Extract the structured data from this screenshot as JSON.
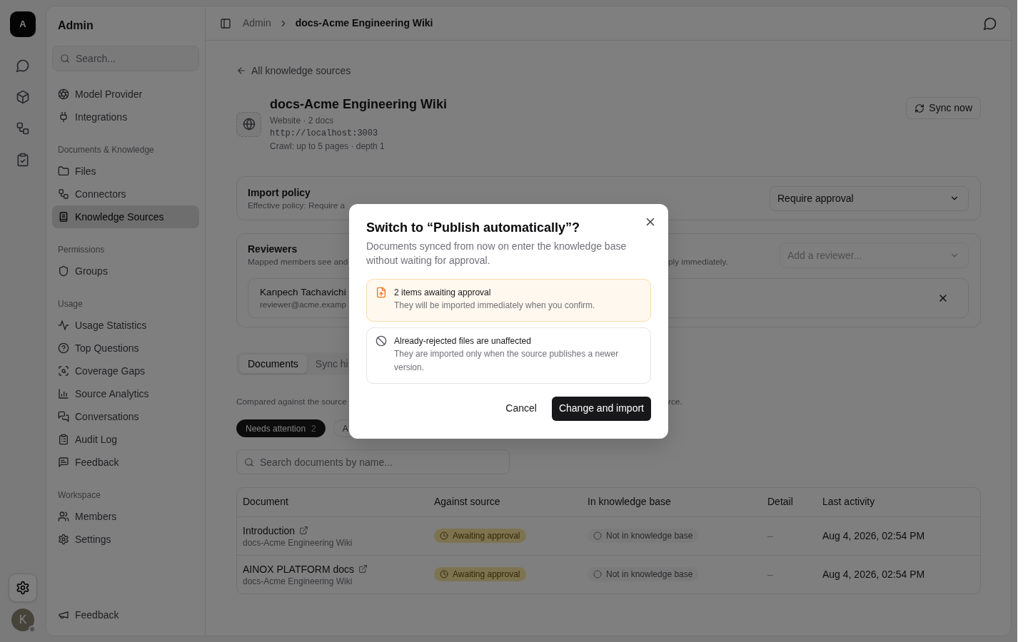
{
  "rail": {
    "logo": "A",
    "nav": [
      {
        "selected": false
      },
      {
        "selected": false
      },
      {
        "selected": false
      },
      {
        "selected": false
      }
    ],
    "settings": {
      "selected": true
    },
    "avatar": {
      "initial": "K",
      "status_dot": true
    }
  },
  "sidebar": {
    "title": "Admin",
    "search": {
      "placeholder": "Search..."
    },
    "sections": [
      {
        "items": [
          {
            "label": "Model Provider",
            "selected": false
          },
          {
            "label": "Integrations",
            "selected": false
          }
        ]
      },
      {
        "heading": "Documents & Knowledge",
        "items": [
          {
            "label": "Files",
            "selected": false
          },
          {
            "label": "Connectors",
            "selected": false
          },
          {
            "label": "Knowledge Sources",
            "selected": true
          }
        ]
      },
      {
        "heading": "Permissions",
        "items": [
          {
            "label": "Groups",
            "selected": false
          }
        ]
      },
      {
        "heading": "Usage",
        "items": [
          {
            "label": "Usage Statistics",
            "selected": false
          },
          {
            "label": "Top Questions",
            "selected": false
          },
          {
            "label": "Coverage Gaps",
            "selected": false
          },
          {
            "label": "Source Analytics",
            "selected": false
          },
          {
            "label": "Conversations",
            "selected": false
          },
          {
            "label": "Audit Log",
            "selected": false
          },
          {
            "label": "Feedback",
            "selected": false
          }
        ]
      },
      {
        "heading": "Workspace",
        "items": [
          {
            "label": "Members",
            "selected": false
          },
          {
            "label": "Settings",
            "selected": false
          }
        ]
      }
    ],
    "footer": {
      "label": "Feedback"
    }
  },
  "header": {
    "breadcrumbs": [
      {
        "label": "Admin",
        "current": false
      },
      {
        "label": "docs-Acme Engineering Wiki",
        "current": true
      }
    ]
  },
  "source": {
    "back_link": "All knowledge sources",
    "title": "docs-Acme Engineering Wiki",
    "meta": "Website · 2 docs",
    "url": "http://localhost:3003",
    "crawl": "Crawl: up to 5 pages · depth 1",
    "sync_button": "Sync now"
  },
  "import_policy": {
    "title": "Import policy",
    "description": "Effective policy: Require a",
    "select": {
      "value": "Require approval"
    }
  },
  "reviewers": {
    "title": "Reviewers",
    "description": "Mapped members see and",
    "description_tail": "ply immediately.",
    "select": {
      "placeholder": "Add a reviewer..."
    },
    "members": [
      {
        "name": "Kanpech Tachavichi",
        "email": "reviewer@acme.examp"
      }
    ]
  },
  "documents": {
    "tabs": [
      {
        "label": "Documents",
        "selected": true
      },
      {
        "label": "Sync hi",
        "selected": false
      }
    ],
    "note": "Compared against the source",
    "note_tail": "rce.",
    "filters": [
      {
        "label": "Needs attention",
        "count": "2",
        "selected": true
      },
      {
        "label": "A",
        "selected": false
      }
    ],
    "search": {
      "placeholder": "Search documents by name..."
    },
    "table": {
      "columns": [
        "Document",
        "Against source",
        "In knowledge base",
        "Detail",
        "Last activity"
      ],
      "rows": [
        {
          "document": "Introduction",
          "source": "docs-Acme Engineering Wiki",
          "against_source": {
            "label": "Awaiting approval",
            "kind": "pending"
          },
          "in_knowledge_base": {
            "label": "Not in knowledge base",
            "kind": "absent"
          },
          "detail": "–",
          "last_activity": "Aug 4, 2026, 02:54 PM"
        },
        {
          "document": "AINOX PLATFORM docs",
          "source": "docs-Acme Engineering Wiki",
          "against_source": {
            "label": "Awaiting approval",
            "kind": "pending"
          },
          "in_knowledge_base": {
            "label": "Not in knowledge base",
            "kind": "absent"
          },
          "detail": "–",
          "last_activity": "Aug 4, 2026, 02:54 PM"
        }
      ]
    }
  },
  "modal": {
    "title": "Switch to “Publish automatically”?",
    "description": "Documents synced from now on enter the knowledge base without waiting for approval.",
    "notices": [
      {
        "kind": "warning",
        "title": "2 items awaiting approval",
        "text": "They will be imported immediately when you confirm."
      },
      {
        "kind": "info",
        "title": "Already-rejected files are unaffected",
        "text": "They are imported only when the source publishes a newer version."
      }
    ],
    "buttons": [
      {
        "label": "Cancel",
        "kind": "secondary"
      },
      {
        "label": "Change and import",
        "kind": "primary"
      }
    ]
  }
}
